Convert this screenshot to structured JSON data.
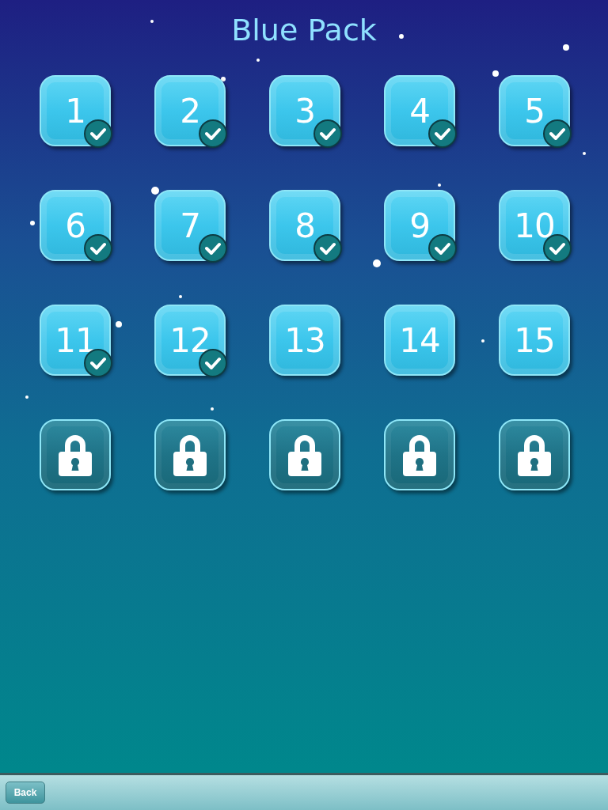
{
  "title": "Blue Pack",
  "levels": [
    {
      "label": "1",
      "locked": false,
      "completed": true
    },
    {
      "label": "2",
      "locked": false,
      "completed": true
    },
    {
      "label": "3",
      "locked": false,
      "completed": true
    },
    {
      "label": "4",
      "locked": false,
      "completed": true
    },
    {
      "label": "5",
      "locked": false,
      "completed": true
    },
    {
      "label": "6",
      "locked": false,
      "completed": true
    },
    {
      "label": "7",
      "locked": false,
      "completed": true
    },
    {
      "label": "8",
      "locked": false,
      "completed": true
    },
    {
      "label": "9",
      "locked": false,
      "completed": true
    },
    {
      "label": "10",
      "locked": false,
      "completed": true
    },
    {
      "label": "11",
      "locked": false,
      "completed": true
    },
    {
      "label": "12",
      "locked": false,
      "completed": true
    },
    {
      "label": "13",
      "locked": false,
      "completed": false
    },
    {
      "label": "14",
      "locked": false,
      "completed": false
    },
    {
      "label": "15",
      "locked": false,
      "completed": false
    },
    {
      "locked": true,
      "completed": false
    },
    {
      "locked": true,
      "completed": false
    },
    {
      "locked": true,
      "completed": false
    },
    {
      "locked": true,
      "completed": false
    },
    {
      "locked": true,
      "completed": false
    }
  ],
  "back_button": "Back"
}
